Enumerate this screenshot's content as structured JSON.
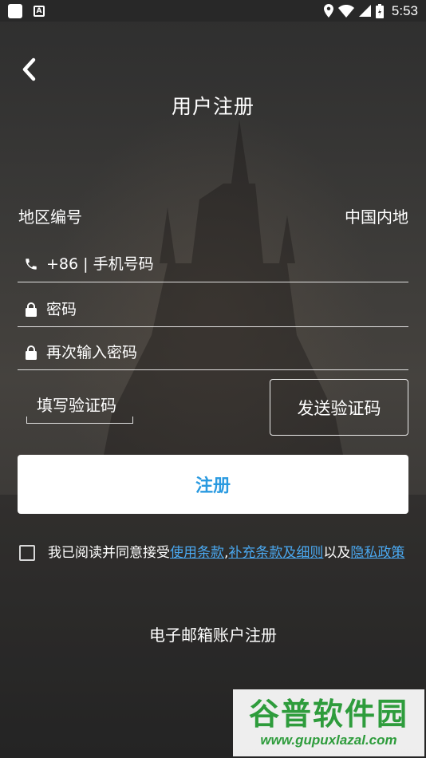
{
  "status_bar": {
    "time": "5:53",
    "icons": [
      "app-square-icon",
      "a-badge-icon",
      "location-icon",
      "wifi-icon",
      "signal-icon",
      "battery-icon"
    ]
  },
  "header": {
    "back_icon": "chevron-left-icon",
    "title": "用户注册"
  },
  "form": {
    "region_label": "地区编号",
    "region_value": "中国内地",
    "phone_icon": "phone-icon",
    "phone_placeholder": "+86 | 手机号码",
    "password_icon": "lock-icon",
    "password_placeholder": "密码",
    "password_confirm_placeholder": "再次输入密码",
    "code_placeholder": "填写验证码",
    "send_code_label": "发送验证码",
    "register_label": "注册"
  },
  "agreement": {
    "checked": false,
    "prefix": "我已阅读并同意接受",
    "link_terms": "使用条款",
    "separator": ",",
    "link_supplement": "补充条款及细则",
    "middle": "以及",
    "link_privacy": "隐私政策"
  },
  "email_register_label": "电子邮箱账户注册",
  "watermark": {
    "title": "谷普软件园",
    "url": "www.gupuxlazal.com"
  },
  "colors": {
    "accent_blue": "#2a9ae0",
    "link_blue": "#4aa8f0",
    "watermark_green": "#2e9c3c"
  }
}
